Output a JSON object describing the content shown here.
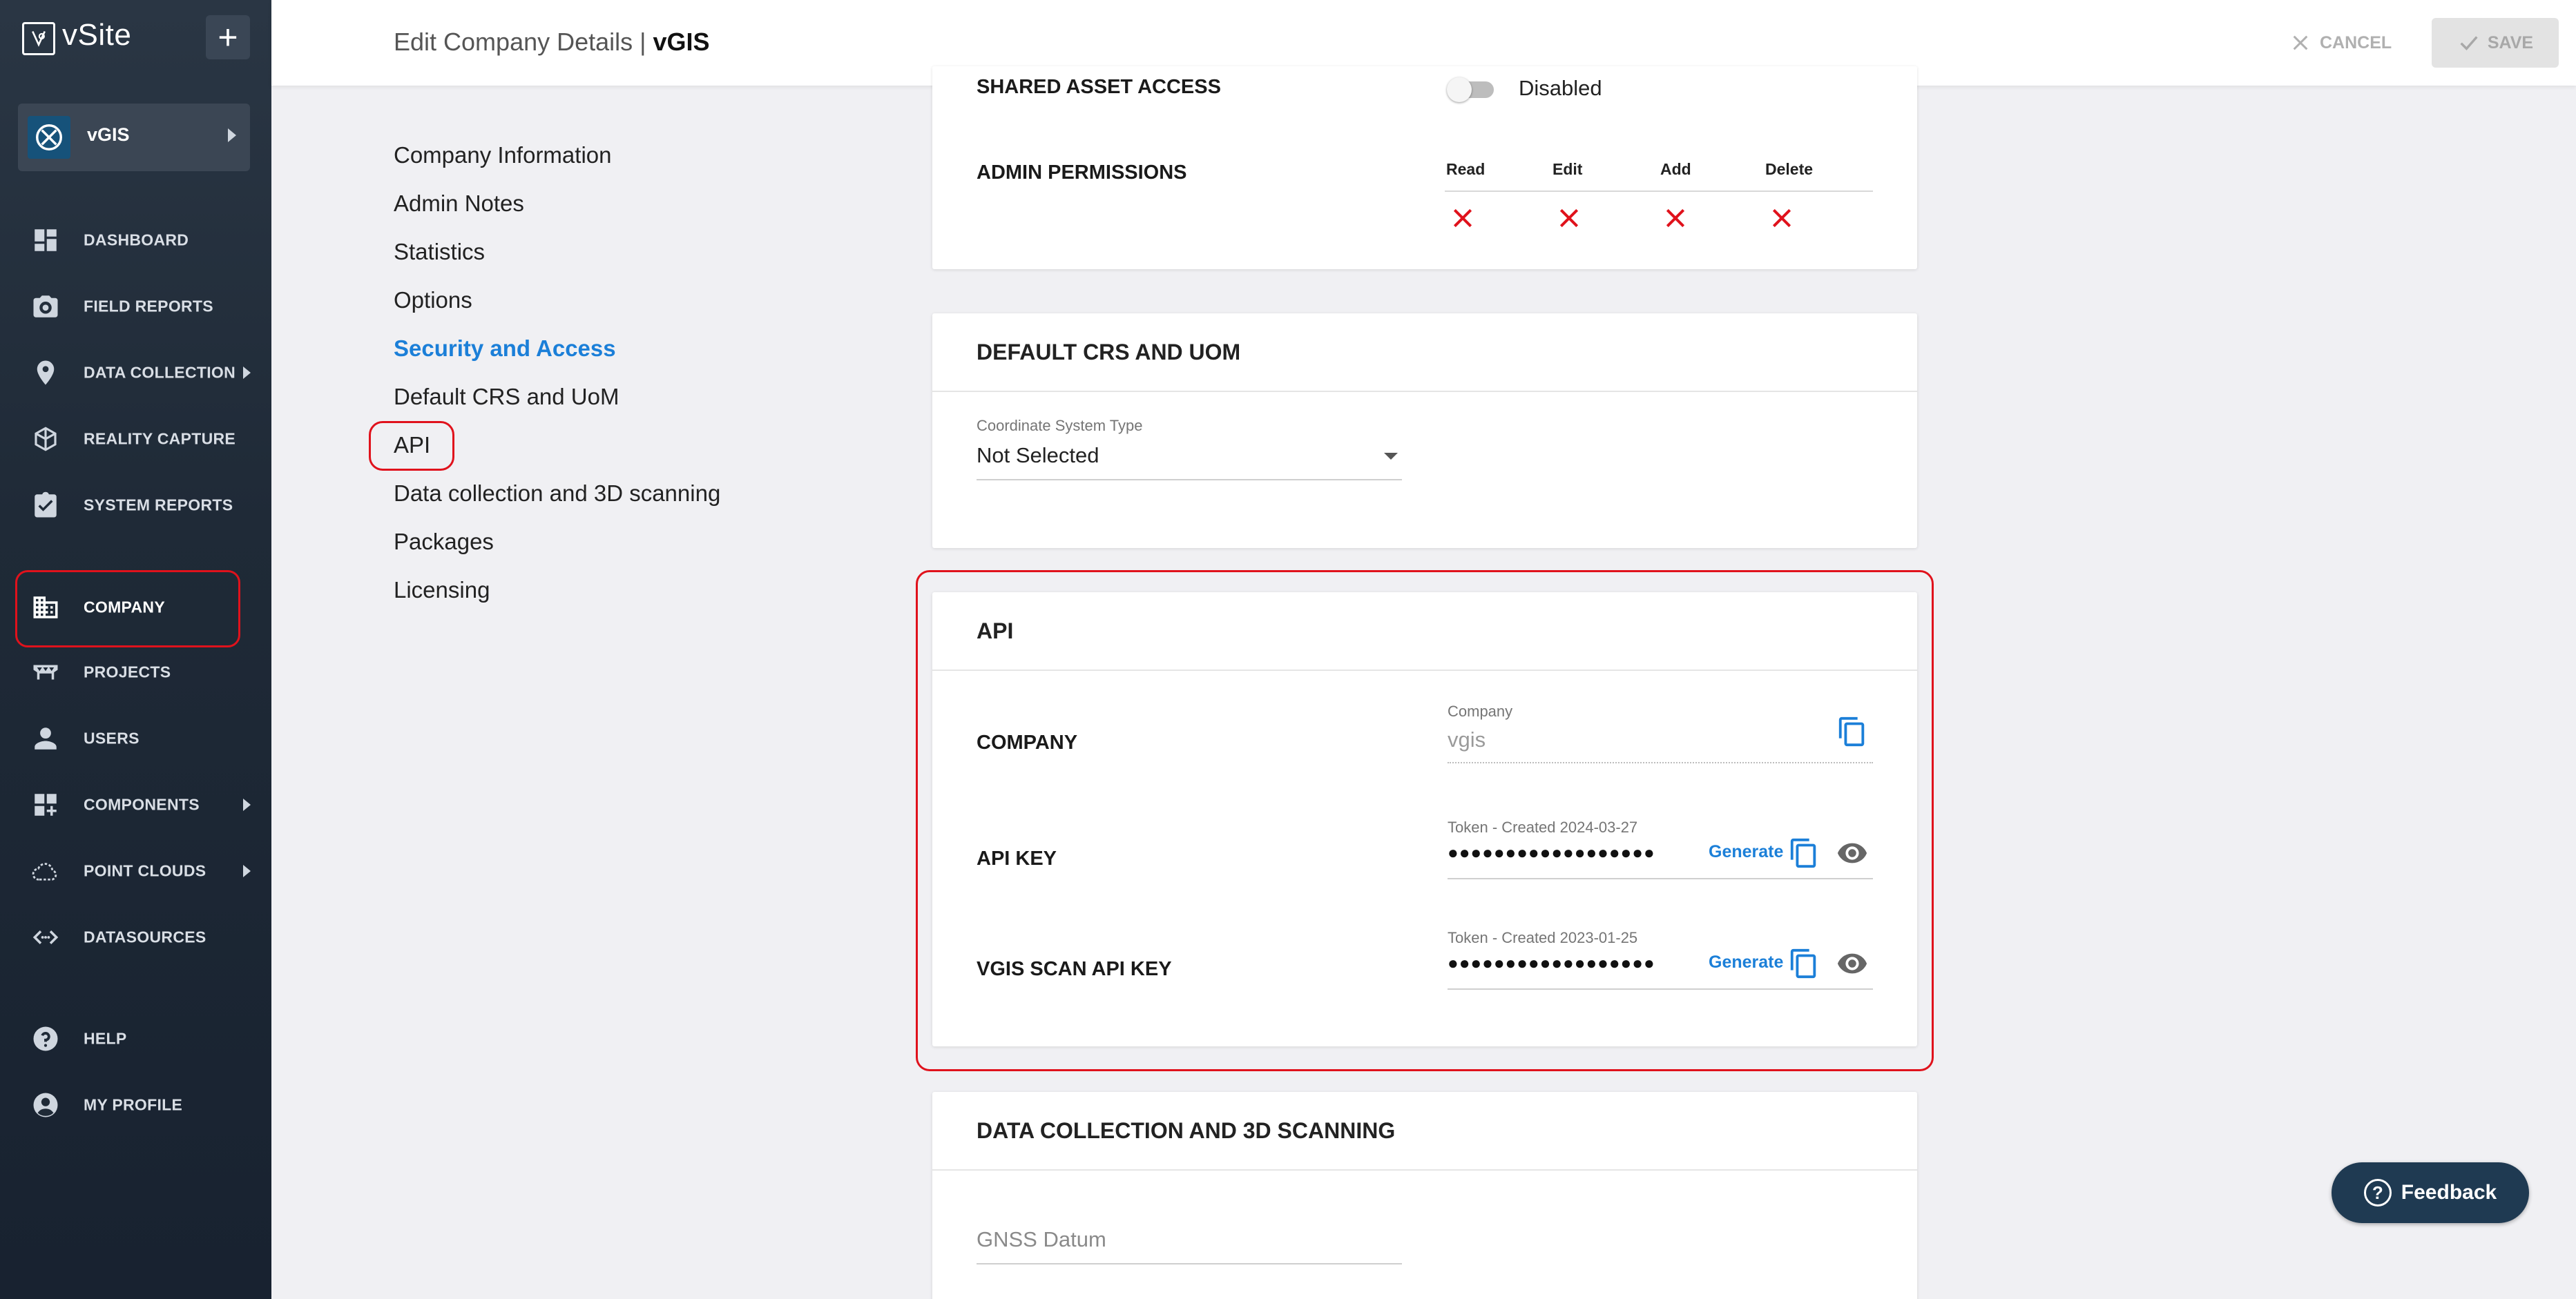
{
  "app": {
    "logo_text": "vSite",
    "org_name": "vGIS"
  },
  "sidebar": {
    "items": [
      {
        "label": "DASHBOARD"
      },
      {
        "label": "FIELD REPORTS"
      },
      {
        "label": "DATA COLLECTION"
      },
      {
        "label": "REALITY CAPTURE"
      },
      {
        "label": "SYSTEM REPORTS"
      },
      {
        "label": "COMPANY"
      },
      {
        "label": "PROJECTS"
      },
      {
        "label": "USERS"
      },
      {
        "label": "COMPONENTS"
      },
      {
        "label": "POINT CLOUDS"
      },
      {
        "label": "DATASOURCES"
      },
      {
        "label": "HELP"
      },
      {
        "label": "MY PROFILE"
      }
    ]
  },
  "header": {
    "title_prefix": "Edit Company Details | ",
    "title_org": "vGIS",
    "cancel_label": "CANCEL",
    "save_label": "SAVE"
  },
  "subnav": {
    "items": [
      {
        "label": "Company Information"
      },
      {
        "label": "Admin Notes"
      },
      {
        "label": "Statistics"
      },
      {
        "label": "Options"
      },
      {
        "label": "Security and Access"
      },
      {
        "label": "Default CRS and UoM"
      },
      {
        "label": "API"
      },
      {
        "label": "Data collection and 3D scanning"
      },
      {
        "label": "Packages"
      },
      {
        "label": "Licensing"
      }
    ]
  },
  "security": {
    "shared_asset_label": "SHARED ASSET ACCESS",
    "shared_asset_value": "Disabled",
    "admin_permissions_label": "ADMIN PERMISSIONS",
    "perm_headers": [
      "Read",
      "Edit",
      "Add",
      "Delete"
    ]
  },
  "crs": {
    "title": "DEFAULT CRS AND UOM",
    "coord_label": "Coordinate System Type",
    "coord_value": "Not Selected"
  },
  "api": {
    "title": "API",
    "company_label": "COMPANY",
    "company_field_label": "Company",
    "company_field_value": "vgis",
    "api_key_label": "API KEY",
    "api_key_token_label": "Token - Created 2024-03-27",
    "vgis_scan_label": "VGIS SCAN API KEY",
    "vgis_scan_token_label": "Token - Created 2023-01-25",
    "masked_token": "●●●●●●●●●●●●●●●●●●",
    "generate_label": "Generate"
  },
  "data_collection": {
    "title": "DATA COLLECTION AND 3D SCANNING",
    "gnss_placeholder": "GNSS Datum"
  },
  "feedback": {
    "label": "Feedback"
  },
  "colors": {
    "accent": "#1b7fd8",
    "highlight": "#e0121c",
    "deny": "#e0121c",
    "sidebar": "#1f2a37"
  }
}
